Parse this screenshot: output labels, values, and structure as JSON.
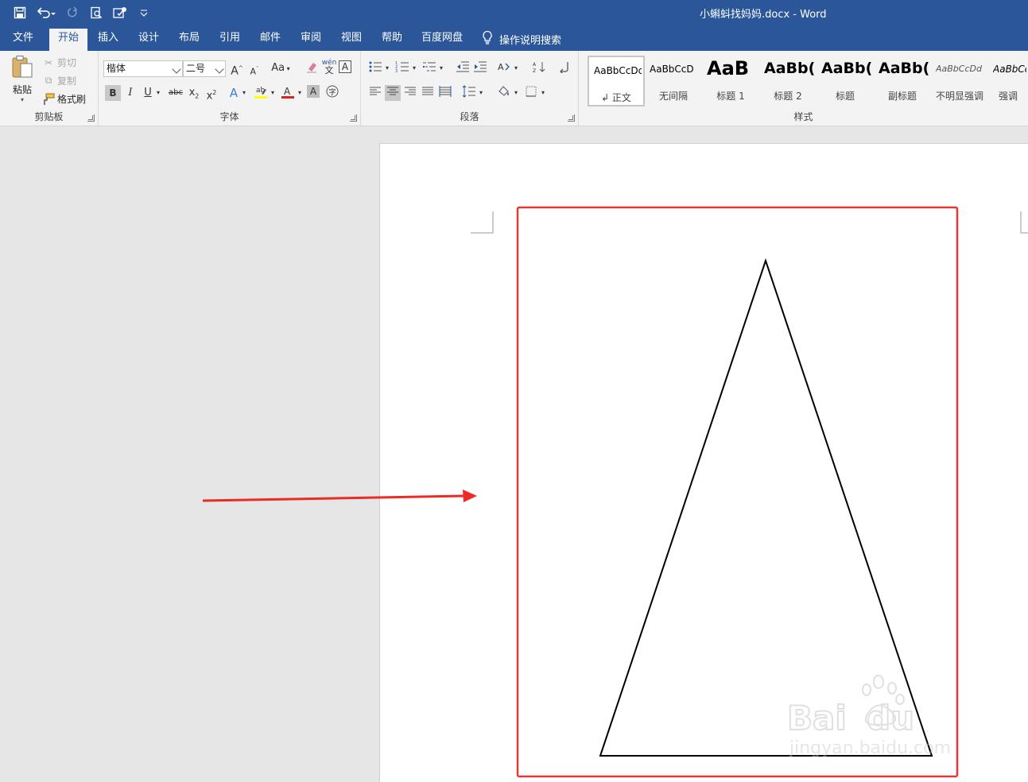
{
  "window": {
    "title": "小蝌蚪找妈妈.docx  -  Word"
  },
  "quick_access": {
    "icons": [
      "save-icon",
      "undo-icon",
      "redo-icon",
      "print-preview-icon",
      "touch-mode-icon",
      "customize-icon"
    ]
  },
  "tabs": [
    {
      "label": "文件"
    },
    {
      "label": "开始"
    },
    {
      "label": "插入"
    },
    {
      "label": "设计"
    },
    {
      "label": "布局"
    },
    {
      "label": "引用"
    },
    {
      "label": "邮件"
    },
    {
      "label": "审阅"
    },
    {
      "label": "视图"
    },
    {
      "label": "帮助"
    },
    {
      "label": "百度网盘"
    }
  ],
  "active_tab": "开始",
  "tell_me": {
    "label": "操作说明搜索"
  },
  "clipboard": {
    "group_label": "剪贴板",
    "paste": "粘贴",
    "cut": "剪切",
    "copy": "复制",
    "format_painter": "格式刷"
  },
  "font": {
    "group_label": "字体",
    "font_name": "楷体",
    "font_size": "二号",
    "change_case": "Aa",
    "phonetic": "wén",
    "phonetic_char": "文"
  },
  "paragraph": {
    "group_label": "段落"
  },
  "styles": {
    "group_label": "样式",
    "items": [
      {
        "sample": "AaBbCcDc",
        "name": "↲ 正文"
      },
      {
        "sample": "AaBbCcD",
        "name": "无间隔"
      },
      {
        "sample": "AaB",
        "name": "标题 1"
      },
      {
        "sample": "AaBb(",
        "name": "标题 2"
      },
      {
        "sample": "AaBb(",
        "name": "标题"
      },
      {
        "sample": "AaBb(",
        "name": "副标题"
      },
      {
        "sample": "AaBbCcDd",
        "name": "不明显强调"
      },
      {
        "sample": "AaBbCcl",
        "name": "强调"
      }
    ]
  },
  "colors": {
    "title_bar": "#2b579a",
    "ribbon": "#f3f3f3",
    "canvas": "#e6e6e6",
    "highlight_box": "#e53935",
    "arrow": "#ee2a24",
    "highlight_yellow": "#ffff00",
    "font_red": "#e01f1f"
  }
}
